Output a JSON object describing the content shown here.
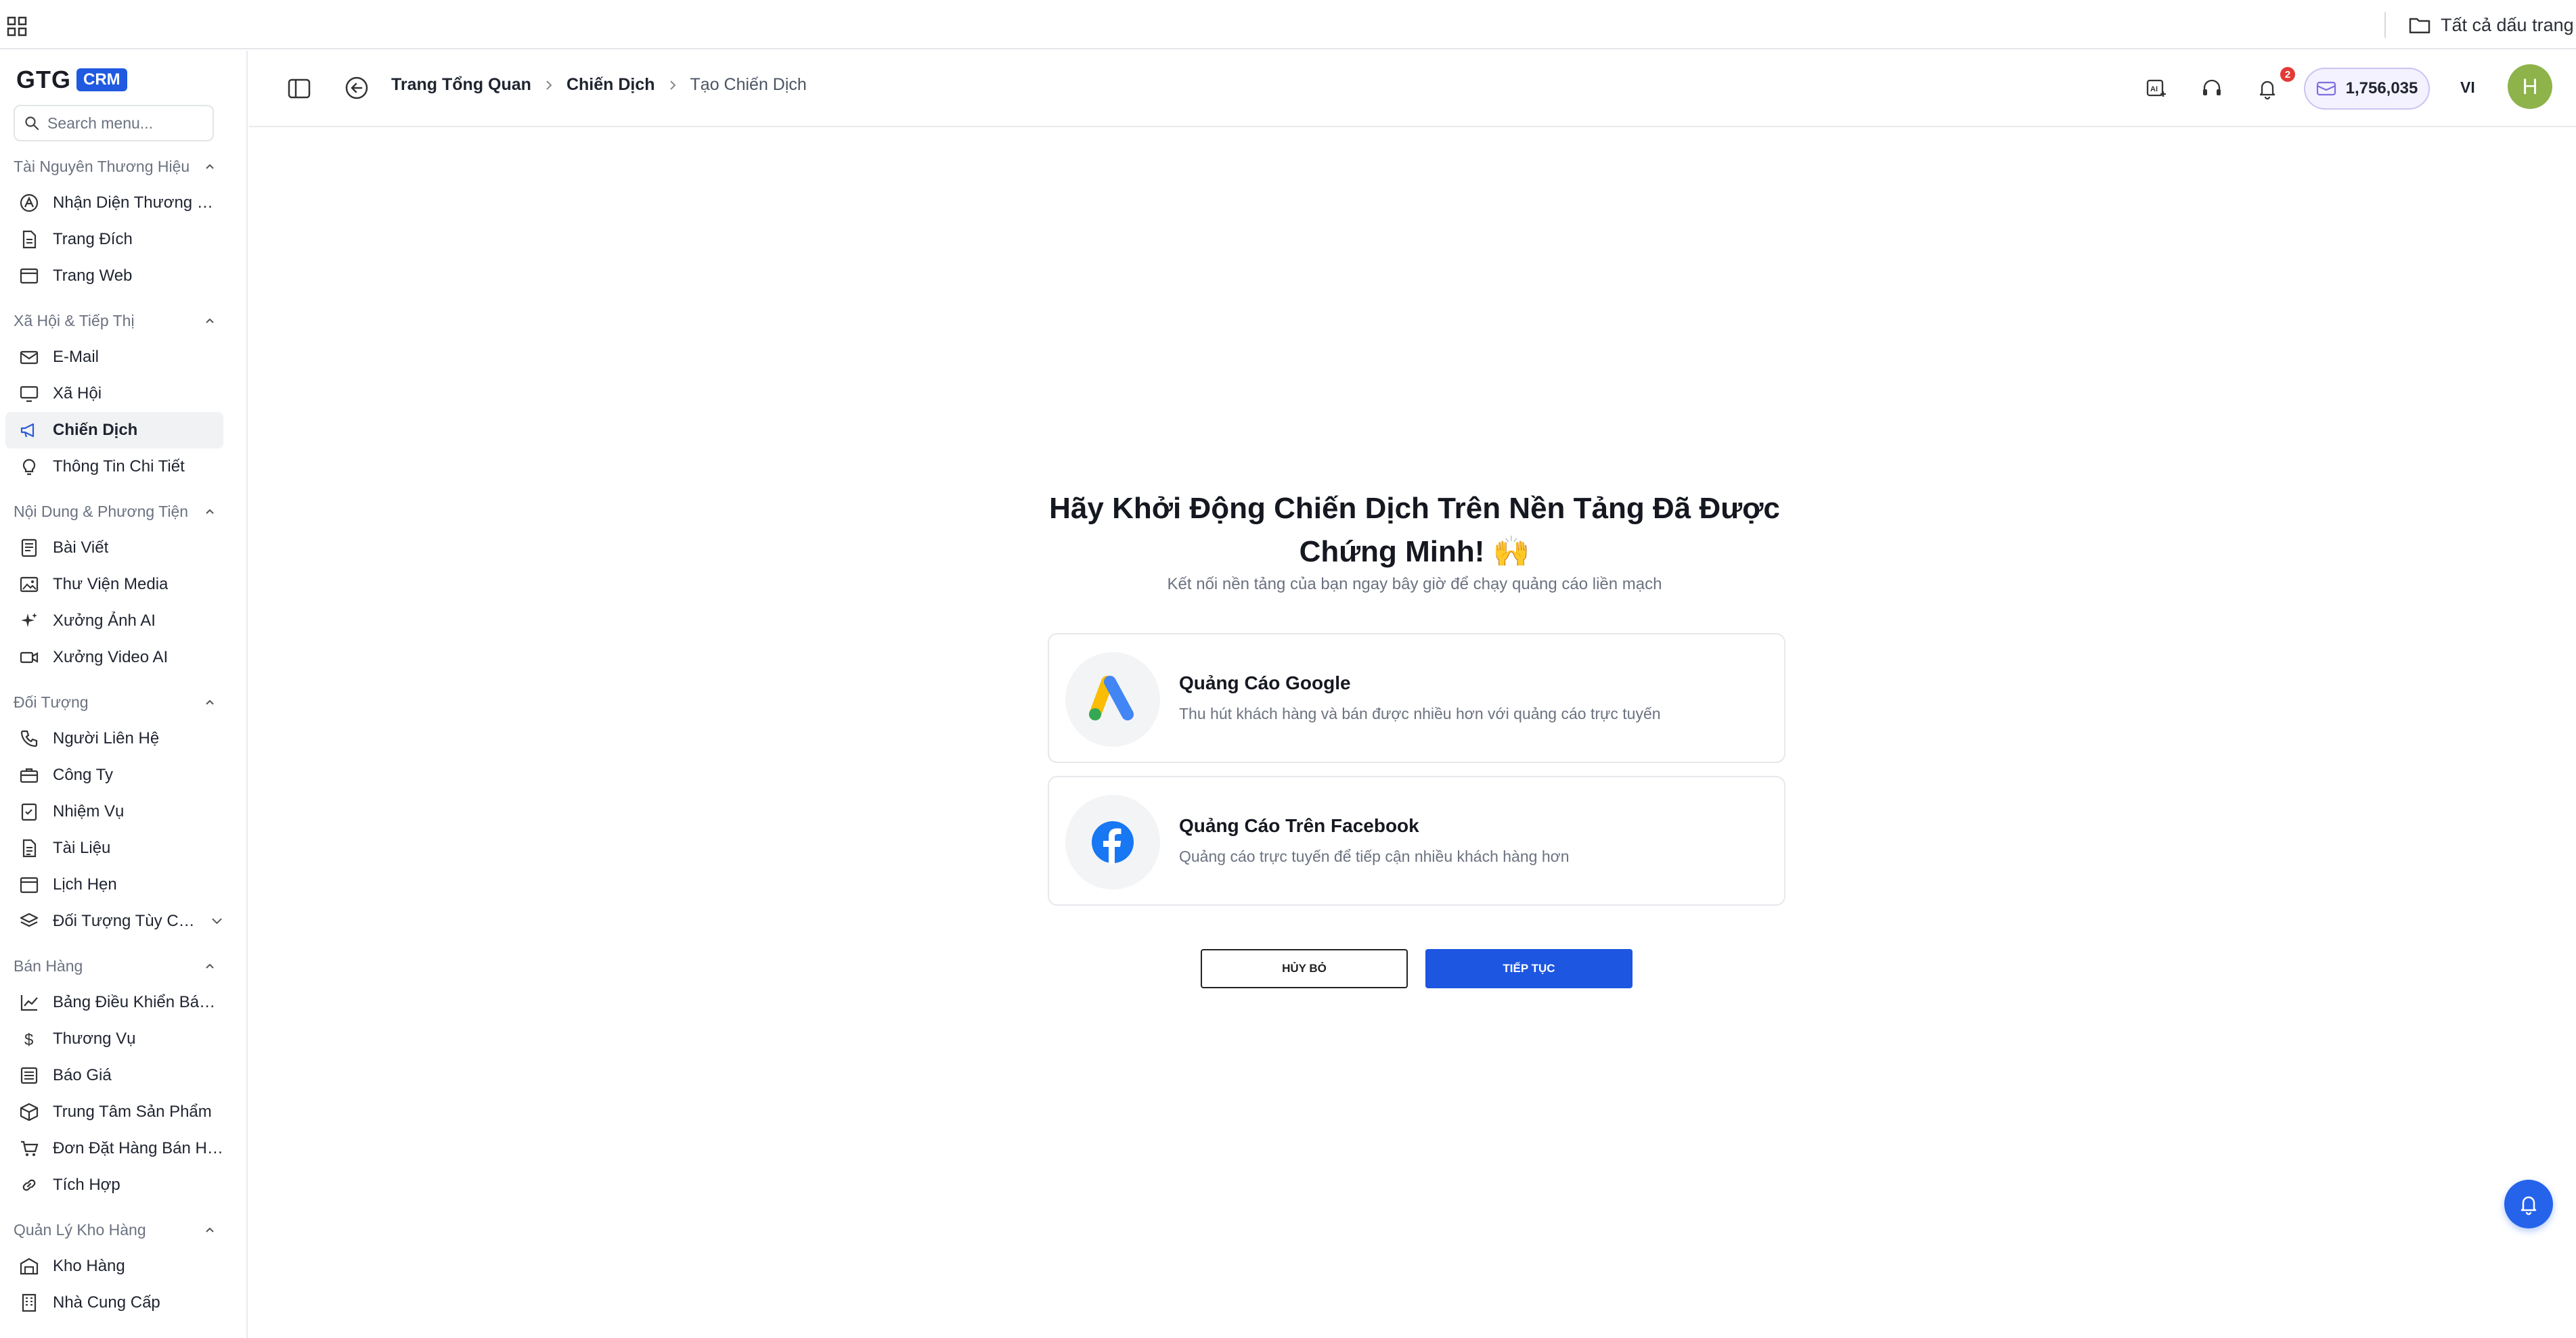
{
  "bookmarks": {
    "all_bookmarks": "Tất cả dấu trang"
  },
  "sidebar": {
    "logo": "GTG",
    "logo_badge": "CRM",
    "search_placeholder": "Search menu...",
    "sections": [
      {
        "title": "Tài Nguyên Thương Hiệu",
        "items": [
          {
            "label": "Nhận Diện Thương Hi...",
            "icon": "brand-icon"
          },
          {
            "label": "Trang Đích",
            "icon": "document-icon"
          },
          {
            "label": "Trang Web",
            "icon": "browser-window-icon"
          }
        ]
      },
      {
        "title": "Xã Hội & Tiếp Thị",
        "items": [
          {
            "label": "E-Mail",
            "icon": "mail-icon"
          },
          {
            "label": "Xã Hội",
            "icon": "monitor-icon"
          },
          {
            "label": "Chiến Dịch",
            "icon": "megaphone-icon",
            "active": true
          },
          {
            "label": "Thông Tin Chi Tiết",
            "icon": "lightbulb-icon"
          }
        ]
      },
      {
        "title": "Nội Dung & Phương Tiện",
        "items": [
          {
            "label": "Bài Viết",
            "icon": "article-icon"
          },
          {
            "label": "Thư Viện Media",
            "icon": "image-library-icon"
          },
          {
            "label": "Xưởng Ảnh AI",
            "icon": "sparkle-icon"
          },
          {
            "label": "Xưởng Video AI",
            "icon": "video-icon"
          }
        ]
      },
      {
        "title": "Đối Tượng",
        "items": [
          {
            "label": "Người Liên Hệ",
            "icon": "phone-icon"
          },
          {
            "label": "Công Ty",
            "icon": "briefcase-icon"
          },
          {
            "label": "Nhiệm Vụ",
            "icon": "checklist-icon"
          },
          {
            "label": "Tài Liệu",
            "icon": "file-icon"
          },
          {
            "label": "Lịch Hẹn",
            "icon": "calendar-icon"
          },
          {
            "label": "Đối Tượng Tùy Chỉnh",
            "icon": "layers-icon",
            "expandable": true
          }
        ]
      },
      {
        "title": "Bán Hàng",
        "items": [
          {
            "label": "Bảng Điều Khiển Bán ...",
            "icon": "chart-line-icon"
          },
          {
            "label": "Thương Vụ",
            "icon": "dollar-icon"
          },
          {
            "label": "Báo Giá",
            "icon": "quote-icon"
          },
          {
            "label": "Trung Tâm Sản Phẩm",
            "icon": "box-icon"
          },
          {
            "label": "Đơn Đặt Hàng Bán Hà...",
            "icon": "cart-icon"
          },
          {
            "label": "Tích Hợp",
            "icon": "link-icon"
          }
        ]
      },
      {
        "title": "Quản Lý Kho Hàng",
        "items": [
          {
            "label": "Kho Hàng",
            "icon": "warehouse-icon"
          },
          {
            "label": "Nhà Cung Cấp",
            "icon": "building-icon"
          }
        ]
      }
    ]
  },
  "header": {
    "breadcrumbs": [
      "Trang Tổng Quan",
      "Chiến Dịch",
      "Tạo Chiến Dịch"
    ],
    "notification_count": "2",
    "credits": "1,756,035",
    "language": "VI",
    "avatar_initial": "H"
  },
  "main": {
    "title": "Hãy Khởi Động Chiến Dịch Trên Nền Tảng Đã Được Chứng Minh! 🙌",
    "subtitle": "Kết nối nền tảng của bạn ngay bây giờ để chạy quảng cáo liền mạch",
    "platforms": [
      {
        "name": "Quảng Cáo Google",
        "description": "Thu hút khách hàng và bán được nhiều hơn với quảng cáo trực tuyến",
        "icon": "google-ads-icon"
      },
      {
        "name": "Quảng Cáo Trên Facebook",
        "description": "Quảng cáo trực tuyến để tiếp cận nhiều khách hàng hơn",
        "icon": "facebook-icon"
      }
    ],
    "cancel_label": "HỦY BỎ",
    "continue_label": "TIẾP TỤC"
  },
  "colors": {
    "accent": "#1d56e0",
    "active_nav_bg": "#f1f2f4",
    "avatar": "#8db34a",
    "badge": "#e53935"
  }
}
